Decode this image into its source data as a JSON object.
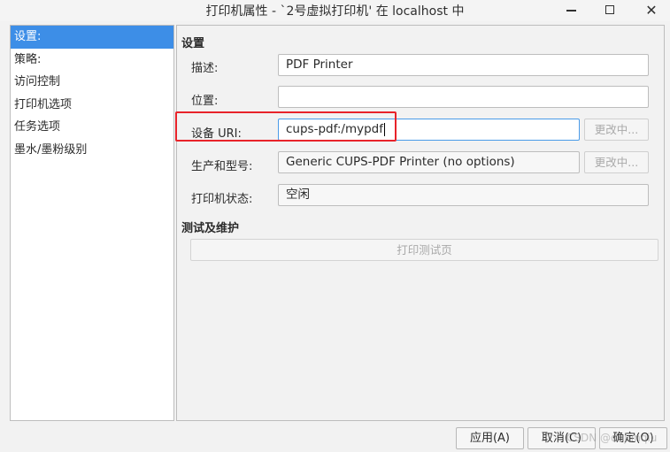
{
  "window": {
    "title": "打印机属性 - `2号虚拟打印机' 在 localhost 中"
  },
  "sidebar": {
    "items": [
      {
        "label": "设置:"
      },
      {
        "label": "策略:"
      },
      {
        "label": "访问控制"
      },
      {
        "label": "打印机选项"
      },
      {
        "label": "任务选项"
      },
      {
        "label": "墨水/墨粉级别"
      }
    ],
    "selected_index": 0
  },
  "settings": {
    "section_title": "设置",
    "description_label": "描述:",
    "description_value": "PDF Printer",
    "location_label": "位置:",
    "location_value": "",
    "device_uri_label": "设备 URI:",
    "device_uri_value": "cups-pdf:/mypdf",
    "device_uri_change_label": "更改中...",
    "make_model_label": "生产和型号:",
    "make_model_value": "Generic CUPS-PDF Printer (no options)",
    "make_model_change_label": "更改中...",
    "printer_state_label": "打印机状态:",
    "printer_state_value": "空闲"
  },
  "maintenance": {
    "section_title": "测试及维护",
    "print_test_page_label": "打印测试页"
  },
  "footer": {
    "apply_label": "应用(A)",
    "cancel_label": "取消(C)",
    "ok_label": "确定(O)"
  },
  "watermark": "CSDN @dujunqiu",
  "colors": {
    "selection": "#3d8ee7",
    "highlight_box": "#e8232a",
    "focus_border": "#4a9be8"
  },
  "icons": {
    "minimize": "minimize-icon",
    "maximize": "maximize-icon",
    "close": "close-icon"
  }
}
